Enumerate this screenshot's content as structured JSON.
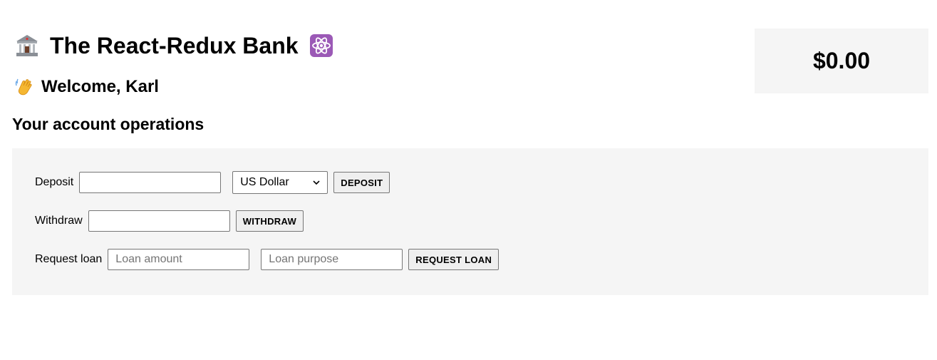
{
  "header": {
    "title": "The React-Redux Bank",
    "title_left_icon": "bank-building-icon",
    "title_right_icon": "atom-icon"
  },
  "customer": {
    "welcome_text": "Welcome, Karl",
    "wave_icon": "waving-hand-icon"
  },
  "balance": {
    "value": "$0.00"
  },
  "operations": {
    "title": "Your account operations",
    "deposit": {
      "label": "Deposit",
      "amount_value": "",
      "currency_selected": "US Dollar",
      "button_label": "DEPOSIT"
    },
    "withdraw": {
      "label": "Withdraw",
      "amount_value": "",
      "button_label": "WITHDRAW"
    },
    "loan": {
      "label": "Request loan",
      "amount_placeholder": "Loan amount",
      "purpose_placeholder": "Loan purpose",
      "button_label": "REQUEST LOAN"
    }
  },
  "colors": {
    "panel_background": "#f5f5f5",
    "atom_badge": "#9b59b6"
  }
}
